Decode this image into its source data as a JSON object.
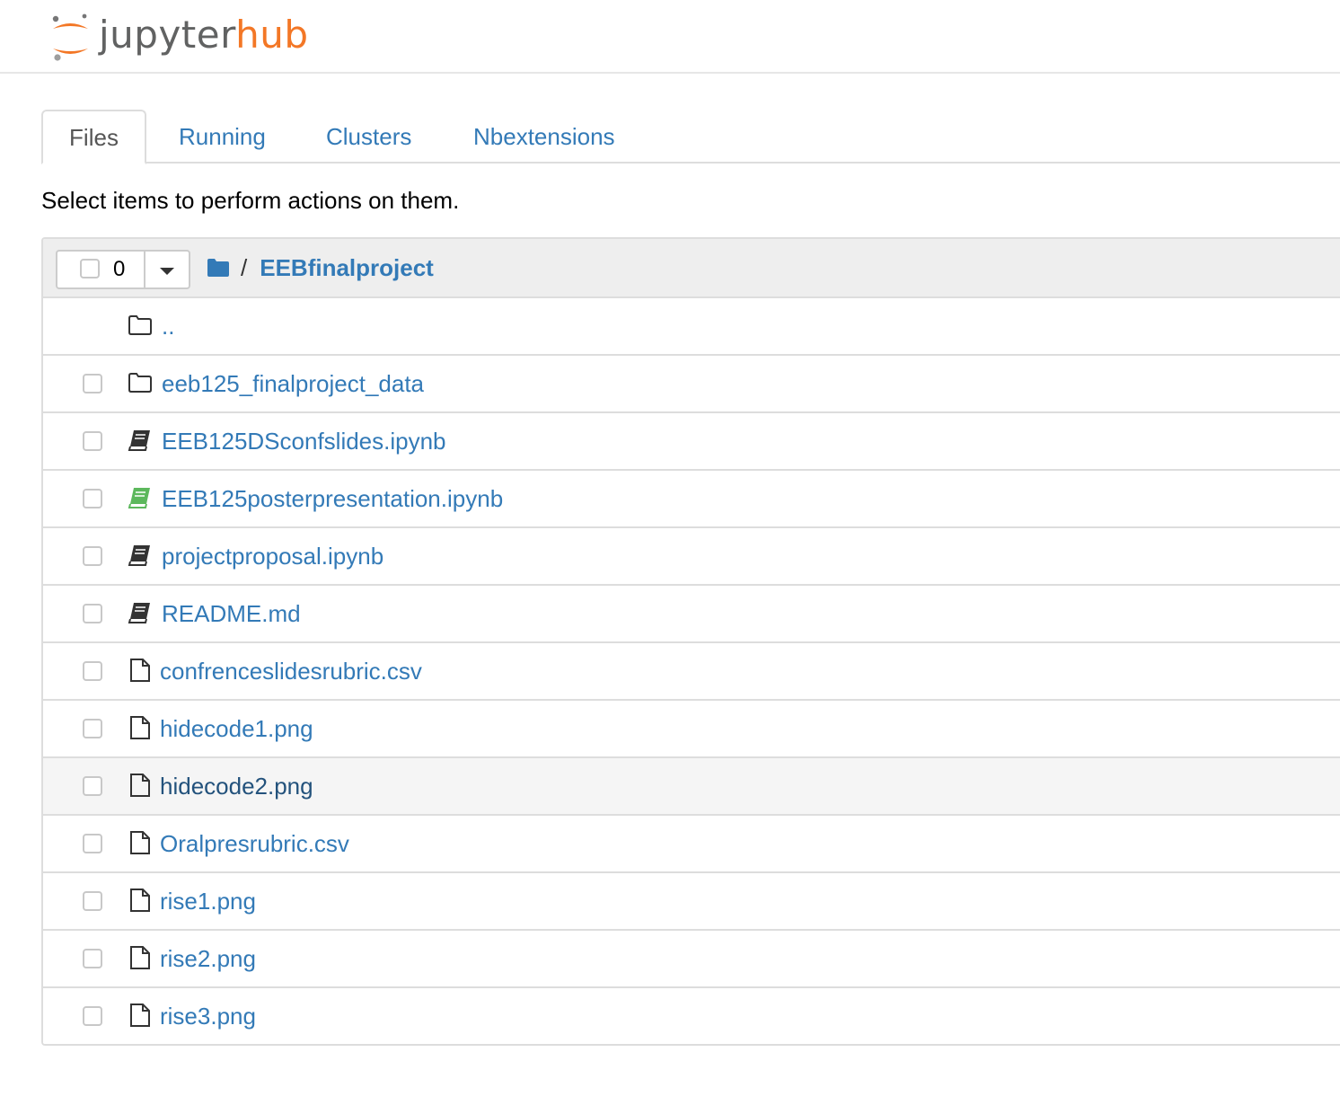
{
  "brand": {
    "word_left": "jupyter",
    "word_right": "hub",
    "colors": {
      "orange": "#f37726",
      "gray": "#616262"
    }
  },
  "tabs": [
    {
      "label": "Files",
      "active": true
    },
    {
      "label": "Running",
      "active": false
    },
    {
      "label": "Clusters",
      "active": false
    },
    {
      "label": "Nbextensions",
      "active": false
    }
  ],
  "instructions": "Select items to perform actions on them.",
  "toolbar": {
    "selected_count": "0",
    "path_separator": "/",
    "current_folder": "EEBfinalproject"
  },
  "files": [
    {
      "name": "..",
      "type": "folder",
      "checkbox": false
    },
    {
      "name": "eeb125_finalproject_data",
      "type": "folder",
      "checkbox": true
    },
    {
      "name": "EEB125DSconfslides.ipynb",
      "type": "notebook",
      "checkbox": true
    },
    {
      "name": "EEB125posterpresentation.ipynb",
      "type": "notebook-running",
      "checkbox": true
    },
    {
      "name": "projectproposal.ipynb",
      "type": "notebook",
      "checkbox": true
    },
    {
      "name": "README.md",
      "type": "notebook",
      "checkbox": true
    },
    {
      "name": "confrenceslidesrubric.csv",
      "type": "file",
      "checkbox": true
    },
    {
      "name": "hidecode1.png",
      "type": "file",
      "checkbox": true
    },
    {
      "name": "hidecode2.png",
      "type": "file",
      "checkbox": true,
      "hover": true
    },
    {
      "name": "Oralpresrubric.csv",
      "type": "file",
      "checkbox": true
    },
    {
      "name": "rise1.png",
      "type": "file",
      "checkbox": true
    },
    {
      "name": "rise2.png",
      "type": "file",
      "checkbox": true
    },
    {
      "name": "rise3.png",
      "type": "file",
      "checkbox": true
    }
  ],
  "icon_colors": {
    "notebook": "#333333",
    "notebook-running": "#5cb85c",
    "folder": "#333333",
    "file": "#333333",
    "breadcrumb-folder": "#337ab7"
  }
}
